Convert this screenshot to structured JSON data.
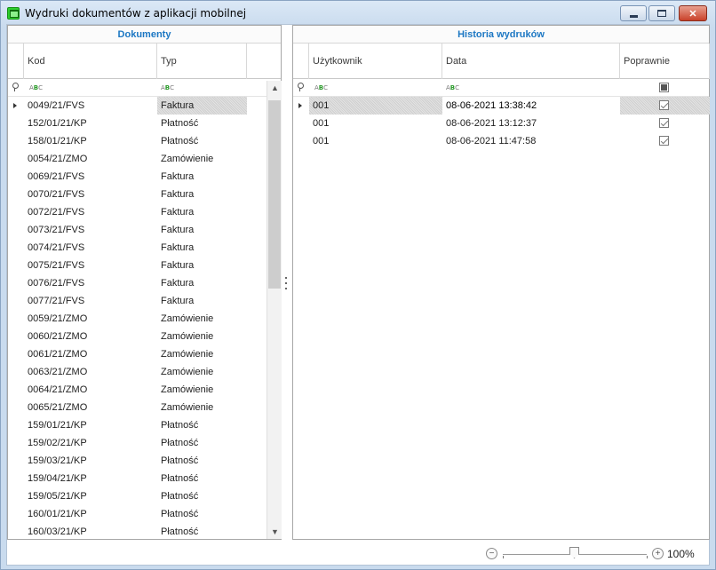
{
  "window": {
    "title": "Wydruki dokumentów z aplikacji mobilnej",
    "buttons": {
      "minimize": "minimize-icon",
      "maximize": "maximize-icon",
      "close": "close-icon"
    }
  },
  "left_panel": {
    "caption": "Dokumenty",
    "columns": [
      "Kod",
      "Typ"
    ],
    "filter_icon": "abc-filter-icon",
    "rows": [
      {
        "kod": "0049/21/FVS",
        "typ": "Faktura"
      },
      {
        "kod": "152/01/21/KP",
        "typ": "Płatność"
      },
      {
        "kod": "158/01/21/KP",
        "typ": "Płatność"
      },
      {
        "kod": "0054/21/ZMO",
        "typ": "Zamówienie"
      },
      {
        "kod": "0069/21/FVS",
        "typ": "Faktura"
      },
      {
        "kod": "0070/21/FVS",
        "typ": "Faktura"
      },
      {
        "kod": "0072/21/FVS",
        "typ": "Faktura"
      },
      {
        "kod": "0073/21/FVS",
        "typ": "Faktura"
      },
      {
        "kod": "0074/21/FVS",
        "typ": "Faktura"
      },
      {
        "kod": "0075/21/FVS",
        "typ": "Faktura"
      },
      {
        "kod": "0076/21/FVS",
        "typ": "Faktura"
      },
      {
        "kod": "0077/21/FVS",
        "typ": "Faktura"
      },
      {
        "kod": "0059/21/ZMO",
        "typ": "Zamówienie"
      },
      {
        "kod": "0060/21/ZMO",
        "typ": "Zamówienie"
      },
      {
        "kod": "0061/21/ZMO",
        "typ": "Zamówienie"
      },
      {
        "kod": "0063/21/ZMO",
        "typ": "Zamówienie"
      },
      {
        "kod": "0064/21/ZMO",
        "typ": "Zamówienie"
      },
      {
        "kod": "0065/21/ZMO",
        "typ": "Zamówienie"
      },
      {
        "kod": "159/01/21/KP",
        "typ": "Płatność"
      },
      {
        "kod": "159/02/21/KP",
        "typ": "Płatność"
      },
      {
        "kod": "159/03/21/KP",
        "typ": "Płatność"
      },
      {
        "kod": "159/04/21/KP",
        "typ": "Płatność"
      },
      {
        "kod": "159/05/21/KP",
        "typ": "Płatność"
      },
      {
        "kod": "160/01/21/KP",
        "typ": "Płatność"
      },
      {
        "kod": "160/03/21/KP",
        "typ": "Płatność"
      }
    ]
  },
  "right_panel": {
    "caption": "Historia wydruków",
    "columns": [
      "Użytkownik",
      "Data",
      "Poprawnie"
    ],
    "rows": [
      {
        "uzytkownik": "001",
        "data": "08-06-2021 13:38:42",
        "poprawnie": true
      },
      {
        "uzytkownik": "001",
        "data": "08-06-2021 13:12:37",
        "poprawnie": true
      },
      {
        "uzytkownik": "001",
        "data": "08-06-2021 11:47:58",
        "poprawnie": true
      }
    ]
  },
  "status": {
    "zoom_minus": "−",
    "zoom_plus": "+",
    "zoom_level": "100%",
    "zoom_fraction": 0.5
  }
}
